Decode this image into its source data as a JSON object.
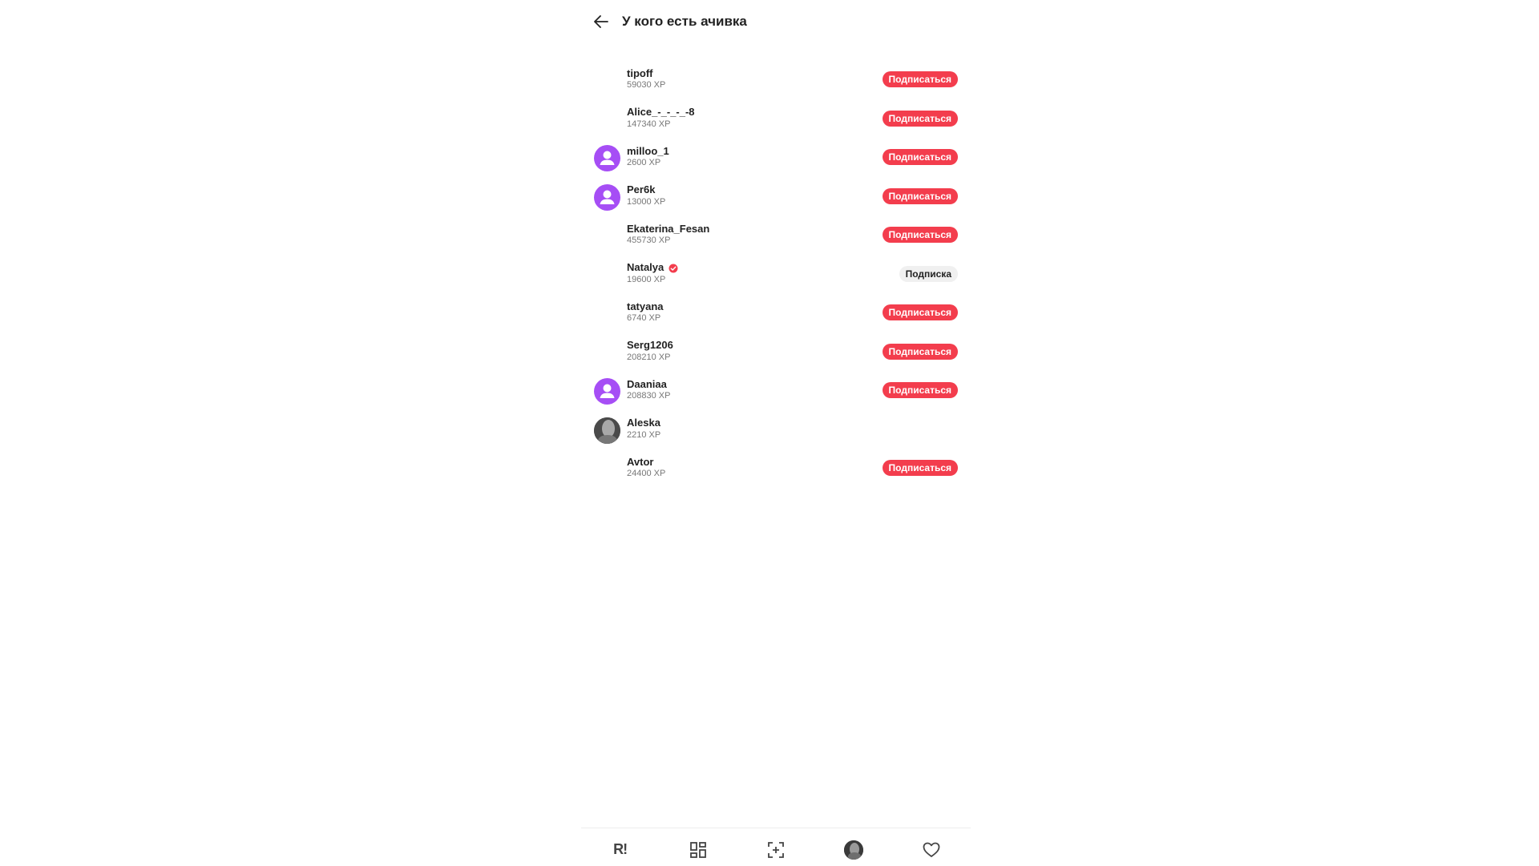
{
  "header": {
    "title": "У кого есть ачивка"
  },
  "users": [
    {
      "name": "tipoff",
      "xp": "59030 XP",
      "avatar": "none",
      "verified": false,
      "button": "Подписаться",
      "button_state": "follow"
    },
    {
      "name": "Alice_-_-_-_-8",
      "xp": "147340 XP",
      "avatar": "none",
      "verified": false,
      "button": "Подписаться",
      "button_state": "follow"
    },
    {
      "name": "milloo_1",
      "xp": "2600 XP",
      "avatar": "default-user-icon",
      "verified": false,
      "button": "Подписаться",
      "button_state": "follow"
    },
    {
      "name": "Per6k",
      "xp": "13000 XP",
      "avatar": "default-user-icon",
      "verified": false,
      "button": "Подписаться",
      "button_state": "follow"
    },
    {
      "name": "Ekaterina_Fesan",
      "xp": "455730 XP",
      "avatar": "none",
      "verified": false,
      "button": "Подписаться",
      "button_state": "follow"
    },
    {
      "name": "Natalya",
      "xp": "19600 XP",
      "avatar": "none",
      "verified": true,
      "button": "Подписка",
      "button_state": "following"
    },
    {
      "name": "tatyana",
      "xp": "6740 XP",
      "avatar": "none",
      "verified": false,
      "button": "Подписаться",
      "button_state": "follow"
    },
    {
      "name": "Serg1206",
      "xp": "208210 XP",
      "avatar": "none",
      "verified": false,
      "button": "Подписаться",
      "button_state": "follow"
    },
    {
      "name": "Daaniaa",
      "xp": "208830 XP",
      "avatar": "default-user-icon",
      "verified": false,
      "button": "Подписаться",
      "button_state": "follow"
    },
    {
      "name": "Aleska",
      "xp": "2210 XP",
      "avatar": "photo",
      "verified": false,
      "button": null,
      "button_state": "none"
    },
    {
      "name": "Avtor",
      "xp": "24400 XP",
      "avatar": "none",
      "verified": false,
      "button": "Подписаться",
      "button_state": "follow"
    }
  ],
  "bottom_nav": {
    "logo_text": "R!",
    "items": [
      "logo-icon",
      "grid-icon",
      "add-photo-icon",
      "profile-avatar",
      "heart-icon"
    ]
  },
  "colors": {
    "accent": "#f33d4d",
    "avatar_default": "#a64ef5",
    "following_bg": "#f0f0f0"
  }
}
